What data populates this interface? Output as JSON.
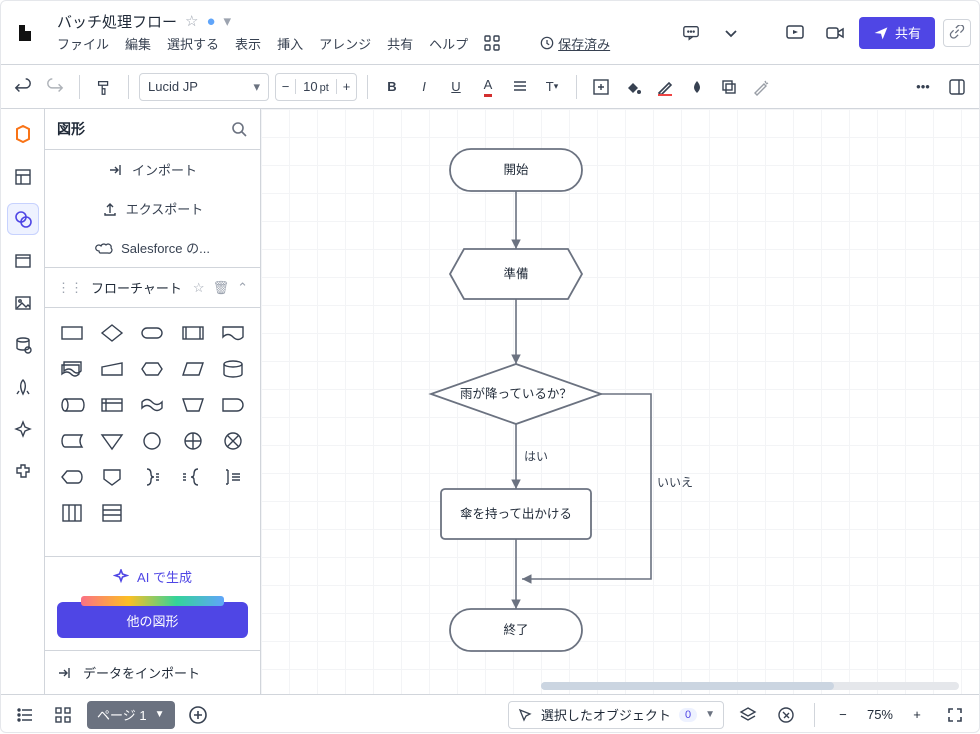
{
  "title": "バッチ処理フロー",
  "menu": {
    "file": "ファイル",
    "edit": "編集",
    "select": "選択する",
    "view": "表示",
    "insert": "挿入",
    "arrange": "アレンジ",
    "share": "共有",
    "help": "ヘルプ",
    "saved": "保存済み"
  },
  "toolbar": {
    "font": "Lucid JP",
    "font_size": "10",
    "font_unit": "pt"
  },
  "share_button": "共有",
  "side": {
    "header": "図形",
    "import": "インポート",
    "export": "エクスポート",
    "salesforce": "Salesforce の...",
    "section": "フローチャート",
    "ai_generate": "AI で生成",
    "more_shapes": "他の図形",
    "import_data": "データをインポート"
  },
  "bottom": {
    "page": "ページ 1",
    "selected": "選択したオブジェクト",
    "selected_count": "0",
    "zoom": "75%"
  },
  "chart_data": {
    "type": "flowchart",
    "nodes": [
      {
        "id": "start",
        "type": "terminator",
        "label": "開始"
      },
      {
        "id": "prep",
        "type": "preparation",
        "label": "準備"
      },
      {
        "id": "dec",
        "type": "decision",
        "label": "雨が降っているか？"
      },
      {
        "id": "act",
        "type": "process",
        "label": "傘を持って出かける"
      },
      {
        "id": "end",
        "type": "terminator",
        "label": "終了"
      }
    ],
    "edges": [
      {
        "from": "start",
        "to": "prep",
        "label": ""
      },
      {
        "from": "prep",
        "to": "dec",
        "label": ""
      },
      {
        "from": "dec",
        "to": "act",
        "label": "はい"
      },
      {
        "from": "dec",
        "to": "end",
        "label": "いいえ",
        "route": "right"
      },
      {
        "from": "act",
        "to": "end",
        "label": ""
      }
    ]
  }
}
